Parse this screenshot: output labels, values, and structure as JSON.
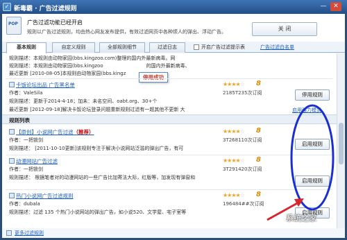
{
  "window": {
    "title": "新毒霸 · 广告过滤规则",
    "min_glyph": "—",
    "close_glyph": "✕"
  },
  "header": {
    "icon_text": "POP",
    "title": "广告过滤功能已经开启",
    "desc": "规则以广告过滤规则，均由热心网友发布提供，有效过滤网页中各种烦人的弹出、浮动广告。",
    "close_label": "关 闭"
  },
  "tabs": [
    {
      "label": "基本规则"
    },
    {
      "label": "自定义规则"
    },
    {
      "label": "全部规则细节"
    },
    {
      "label": "过滤日志"
    }
  ],
  "toolbar": {
    "popup_hint_label": "开启广告过滤提示表",
    "subscribe_label": "广告过滤白名单"
  },
  "top_rule": {
    "desc_line": "规则描述：本规则由动物家园(bbs.kingzoo.com)整理的国内外最新病毒。网",
    "desc_line2": "规则描述：本规则由动物家园(bbs.kingzoo",
    "desc_line2_tail": "的国内外最新病毒、",
    "update_line": "最近更新  [2010-08-05]本规则由动物家园(bbs.kingz"
  },
  "toast": "停用成功",
  "rules_top": [
    {
      "title": "卡饭论坛出品 广告黑名单",
      "author": "作者：ValeSila",
      "stars": "★★★★",
      "stars_off": "☆",
      "score": "8",
      "count": "2185T235次订阅",
      "desc": "规则描述：更新于2014-4-18；加未：未名空间、oabt.org、30+个",
      "update": "最近更新  [2012-09-18]解决卡饭论坛登录问题重新规则过滤有一超其他不更新  大",
      "button": "停用规则",
      "link": "启用强力模式"
    }
  ],
  "section_title": "规则列表",
  "rules": [
    {
      "title": "【原创】小说网广告过滤",
      "tag": "（推荐）",
      "author": "作者：一把锁剑",
      "stars": "★★★★",
      "stars_off": "☆",
      "score": "8",
      "count": "3T268110次订阅",
      "desc": "规则描述：  [2011-10-10更新]该规则专注于解决小说网站泛滥的弹出广告，有可",
      "button": "启用规则"
    },
    {
      "title": "动漫网站广告过滤",
      "tag": "",
      "author": "作者：一把锁剑",
      "stars": "★★★★",
      "stars_off": "☆",
      "score": "8",
      "count": "3T291420次订阅",
      "desc": "规则描述：  根据笔者对的动漫网站的一些广告比加寄法大际，红版等，加发现有弹窗和",
      "button": "启用规则"
    },
    {
      "title": "热门小说网广告过滤规则",
      "tag": "",
      "author": "作者：dubala",
      "stars": "★★★★",
      "stars_off": "☆",
      "score": "8",
      "count": "196484##次订阅",
      "desc": "规则描述：过滤 135 个热门小说网站的弹出广告，如小说520、文学屋、宅子室等",
      "button": "启用规则"
    }
  ],
  "footer": {
    "more_label": "更多过滤规则"
  },
  "watermark": "系统之家",
  "colors": {
    "annotation_ellipse": "#1a2fd0",
    "annotation_arrow": "#d8252a"
  }
}
